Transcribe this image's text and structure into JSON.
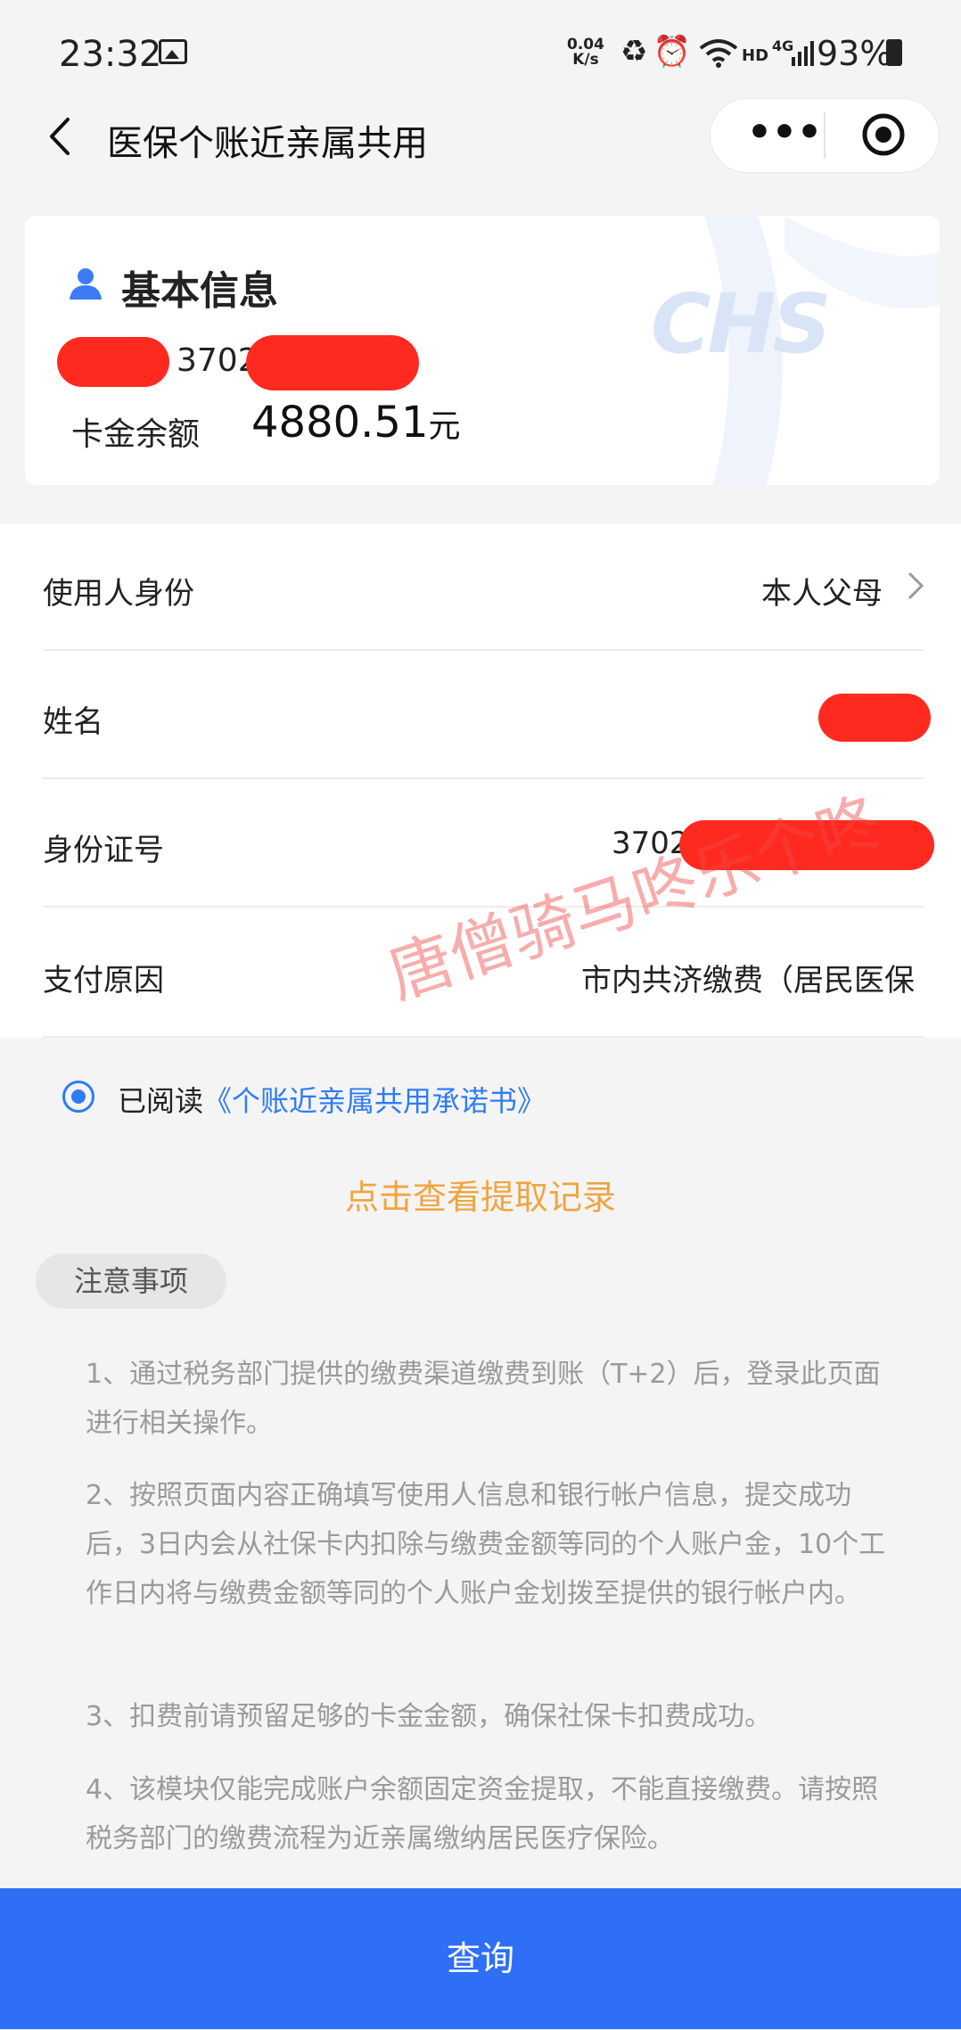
{
  "status_bar": {
    "time": "23:32",
    "net_speed": "0.04",
    "net_unit": "K/s",
    "hd": "HD",
    "network": "4G",
    "battery": "93%"
  },
  "nav": {
    "title": "医保个账近亲属共用",
    "more": "•••"
  },
  "card": {
    "title": "基本信息",
    "id_prefix": "3702",
    "balance_label": "卡金余额",
    "balance_value": "4880.51",
    "balance_unit": "元",
    "logo": "CHS"
  },
  "form": {
    "rows": [
      {
        "label": "使用人身份",
        "value": "本人父母"
      },
      {
        "label": "姓名",
        "value": ""
      },
      {
        "label": "身份证号",
        "value": "3702"
      },
      {
        "label": "支付原因",
        "value": "市内共济缴费（居民医保"
      }
    ]
  },
  "watermark": "唐僧骑马咚乐个咚",
  "agreement": {
    "prefix": "已阅读",
    "link": "《个账近亲属共用承诺书》"
  },
  "records_link": "点击查看提取记录",
  "notice": {
    "title": "注意事项",
    "items": [
      "1、通过税务部门提供的缴费渠道缴费到账（T+2）后，登录此页面进行相关操作。",
      "2、按照页面内容正确填写使用人信息和银行帐户信息，提交成功后，3日内会从社保卡内扣除与缴费金额等同的个人账户金，10个工作日内将与缴费金额等同的个人账户金划拨至提供的银行帐户内。",
      "3、扣费前请预留足够的卡金金额，确保社保卡扣费成功。",
      "4、该模块仅能完成账户余额固定资金提取，不能直接缴费。请按照税务部门的缴费流程为近亲属缴纳居民医疗保险。"
    ]
  },
  "query_button": "查询",
  "colors": {
    "accent": "#2f6ff6",
    "link": "#2f7cf6",
    "orange": "#f0a540",
    "redaction": "#ff2a1f"
  }
}
